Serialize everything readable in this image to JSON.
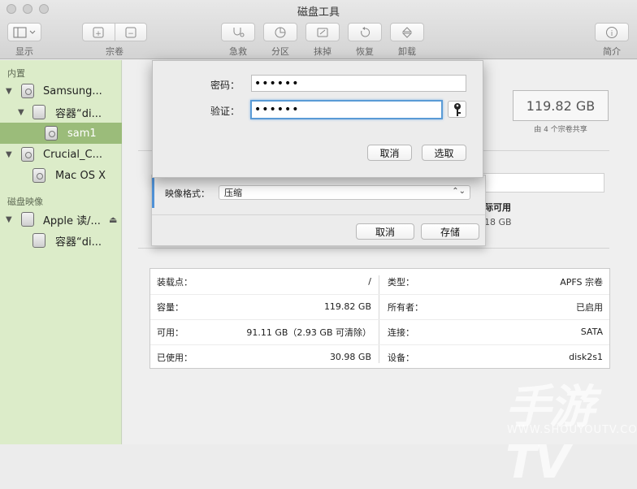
{
  "window": {
    "title": "磁盘工具"
  },
  "toolbar": {
    "view_label": "显示",
    "volume_label": "宗卷",
    "firstaid_label": "急救",
    "partition_label": "分区",
    "erase_label": "抹掉",
    "restore_label": "恢复",
    "unmount_label": "卸载",
    "info_label": "简介"
  },
  "sidebar": {
    "internal_header": "内置",
    "images_header": "磁盘映像",
    "items": [
      {
        "label": "Samsung..."
      },
      {
        "label": "容器“di..."
      },
      {
        "label": "sam1"
      },
      {
        "label": "Crucial_C..."
      },
      {
        "label": "Mac OS X"
      },
      {
        "label": "Apple 读/..."
      },
      {
        "label": "容器“di..."
      }
    ]
  },
  "summary": {
    "capacity": "119.82 GB",
    "shared_note": "由 4 个宗卷共享",
    "partial_col_label": "际可用",
    "partial_col_value": "18 GB"
  },
  "info": {
    "left": [
      {
        "label": "装载点：",
        "value": "/"
      },
      {
        "label": "容量：",
        "value": "119.82 GB"
      },
      {
        "label": "可用：",
        "value": "91.11 GB（2.93 GB 可清除）"
      },
      {
        "label": "已使用：",
        "value": "30.98 GB"
      }
    ],
    "right": [
      {
        "label": "类型：",
        "value": "APFS 宗卷"
      },
      {
        "label": "所有者：",
        "value": "已启用"
      },
      {
        "label": "连接：",
        "value": "SATA"
      },
      {
        "label": "设备：",
        "value": "disk2s1"
      }
    ]
  },
  "save_sheet": {
    "format_label": "映像格式：",
    "format_value": "压缩",
    "cancel_label": "取消",
    "save_label": "存储"
  },
  "password_sheet": {
    "password_label": "密码：",
    "password_value": "••••••",
    "verify_label": "验证：",
    "verify_value": "••••••",
    "cancel_label": "取消",
    "choose_label": "选取"
  },
  "watermark": {
    "text": "手游TV",
    "sub": "WWW.SHOUYOUTV.COM"
  }
}
